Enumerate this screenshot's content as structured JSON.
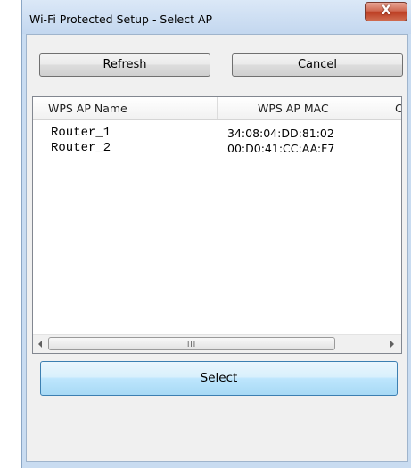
{
  "window": {
    "title": "Wi-Fi Protected Setup - Select AP",
    "close_label": "X"
  },
  "toolbar": {
    "refresh_label": "Refresh",
    "cancel_label": "Cancel"
  },
  "list": {
    "columns": [
      "WPS AP Name",
      "WPS AP MAC",
      "C"
    ],
    "rows": [
      {
        "name": "Router_1",
        "mac": "34:08:04:DD:81:02"
      },
      {
        "name": "Router_2",
        "mac": "00:D0:41:CC:AA:F7"
      }
    ],
    "scroll_grip": "III"
  },
  "footer": {
    "select_label": "Select"
  },
  "colors": {
    "select_accent": "#3c7fb1",
    "close_red": "#c94d33"
  },
  "icons": {
    "close": "close-icon",
    "scroll_left": "scroll-left-arrow-icon",
    "scroll_right": "scroll-right-arrow-icon"
  }
}
